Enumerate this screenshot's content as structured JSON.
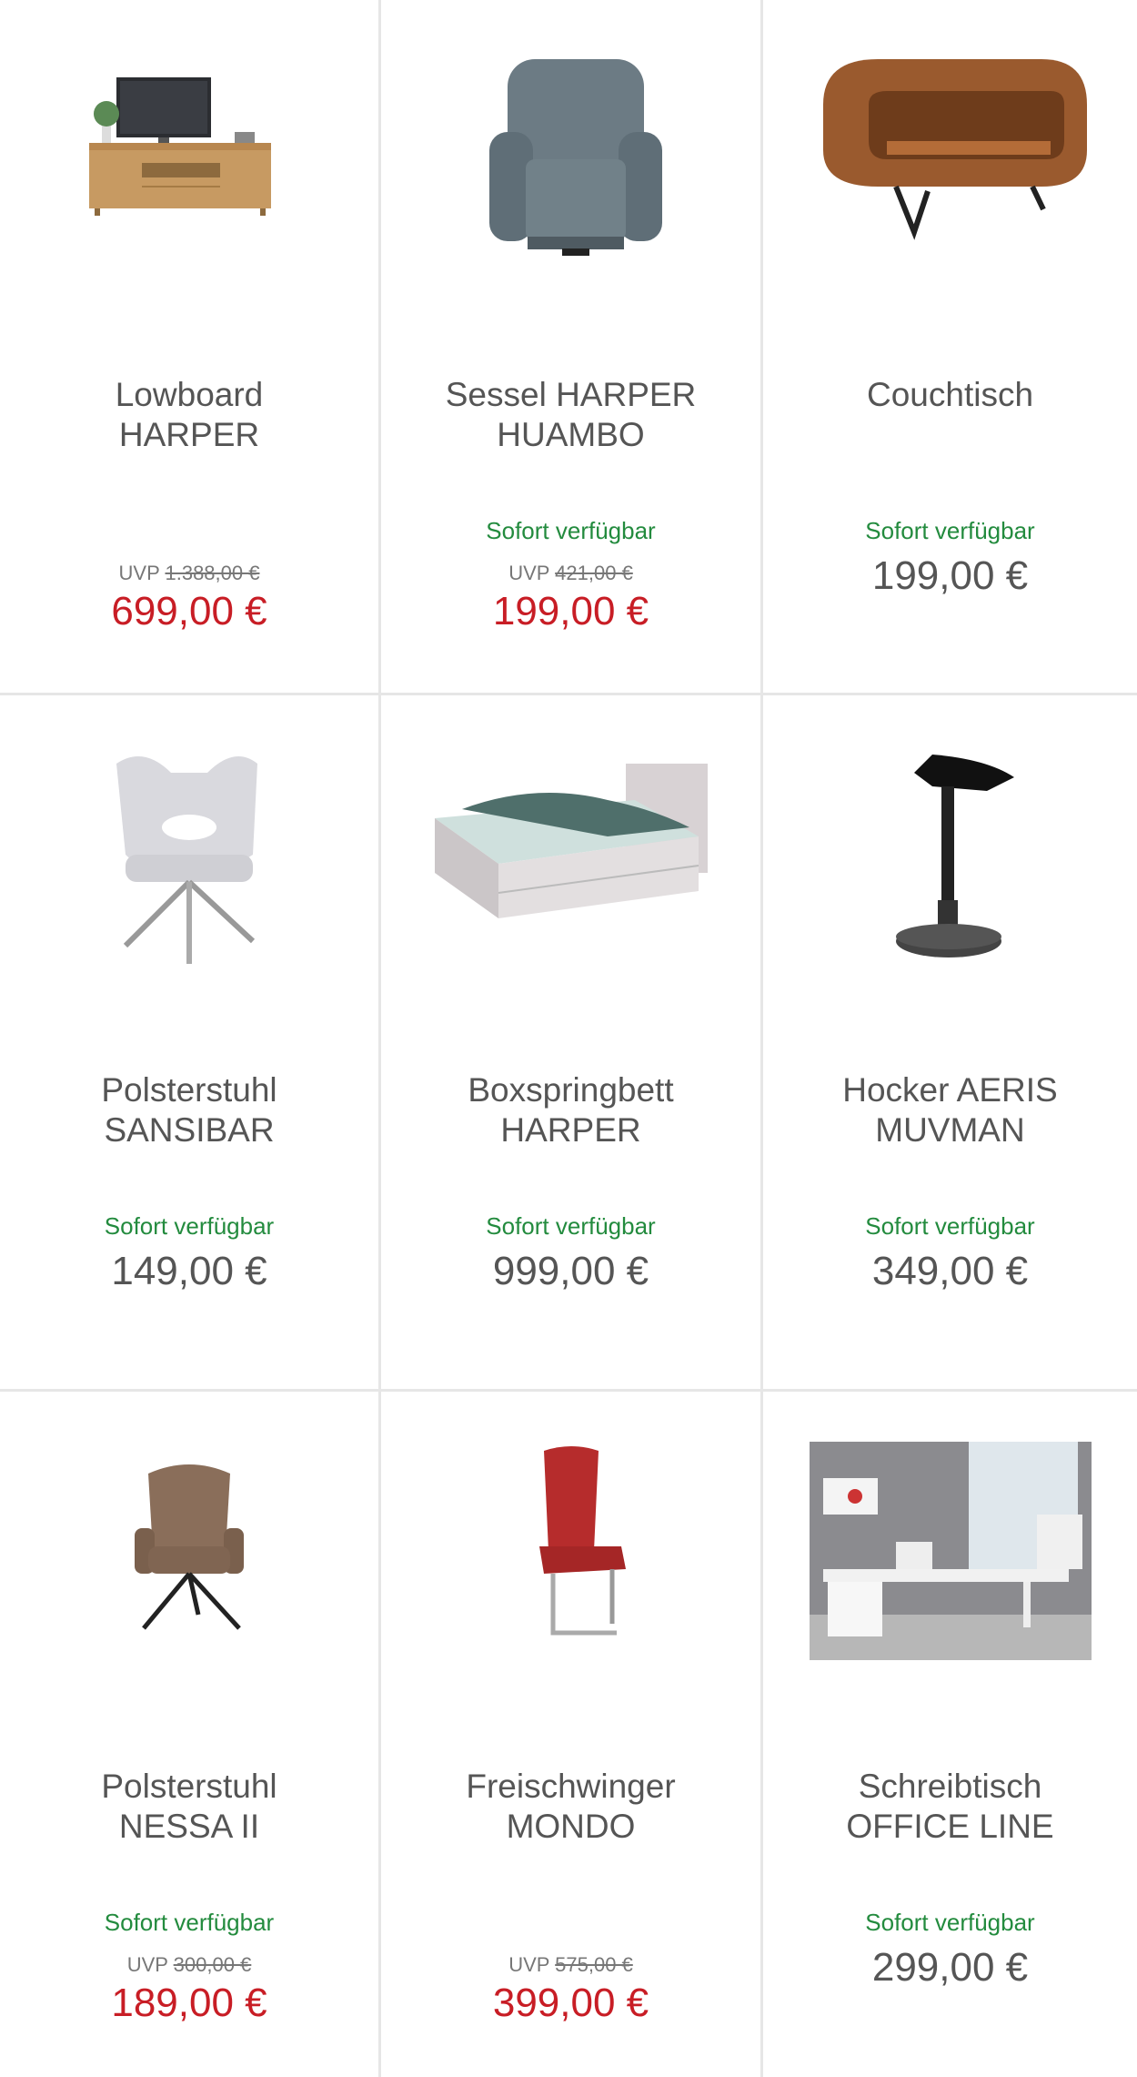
{
  "products": [
    {
      "title_1": "Lowboard",
      "title_2": "HARPER",
      "availability": "",
      "uvp_label": "UVP",
      "uvp_price": "1.388,00 €",
      "price": "699,00 €",
      "icon": "tv-lowboard-image"
    },
    {
      "title_1": "Sessel HARPER",
      "title_2": "HUAMBO",
      "availability": "Sofort verfügbar",
      "uvp_label": "UVP",
      "uvp_price": "421,00 €",
      "price": "199,00 €",
      "icon": "recliner-armchair-image"
    },
    {
      "title_1": "Couchtisch",
      "title_2": "",
      "availability": "Sofort verfügbar",
      "uvp_label": "",
      "uvp_price": "",
      "price": "199,00 €",
      "icon": "wooden-coffee-table-image"
    },
    {
      "title_1": "Polsterstuhl",
      "title_2": "SANSIBAR",
      "availability": "Sofort verfügbar",
      "uvp_label": "",
      "uvp_price": "",
      "price": "149,00 €",
      "icon": "upholstered-chair-image"
    },
    {
      "title_1": "Boxspringbett",
      "title_2": "HARPER",
      "availability": "Sofort verfügbar",
      "uvp_label": "",
      "uvp_price": "",
      "price": "999,00 €",
      "icon": "boxspring-bed-image"
    },
    {
      "title_1": "Hocker AERIS",
      "title_2": "MUVMAN",
      "availability": "Sofort verfügbar",
      "uvp_label": "",
      "uvp_price": "",
      "price": "349,00 €",
      "icon": "standing-stool-image"
    },
    {
      "title_1": "Polsterstuhl",
      "title_2": "NESSA II",
      "availability": "Sofort verfügbar",
      "uvp_label": "UVP",
      "uvp_price": "300,00 €",
      "price": "189,00 €",
      "icon": "swivel-chair-image"
    },
    {
      "title_1": "Freischwinger",
      "title_2": "MONDO",
      "availability": "",
      "uvp_label": "UVP",
      "uvp_price": "575,00 €",
      "price": "399,00 €",
      "icon": "cantilever-chair-image"
    },
    {
      "title_1": "Schreibtisch",
      "title_2": "OFFICE LINE",
      "availability": "Sofort verfügbar",
      "uvp_label": "",
      "uvp_price": "",
      "price": "299,00 €",
      "icon": "office-desk-image"
    }
  ],
  "colors": {
    "availability": "#238b3e",
    "sale_price": "#c81d25",
    "regular_price": "#555555",
    "divider": "#e6e6e6"
  }
}
